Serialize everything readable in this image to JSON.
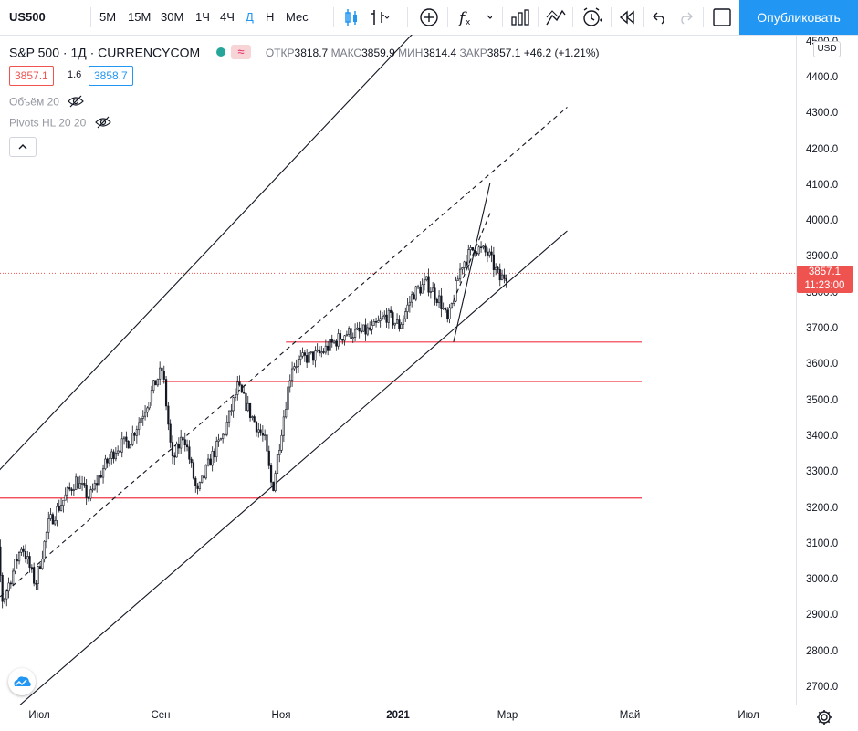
{
  "toolbar": {
    "symbol": "US500",
    "intervals": [
      "5M",
      "15M",
      "30M",
      "1Ч",
      "4Ч",
      "Д",
      "Н",
      "Мес"
    ],
    "active_interval": "Д",
    "publish_label": "Опубликовать"
  },
  "legend": {
    "title": "S&P 500 · 1Д · CURRENCYCOM",
    "open_label": "ОТКР",
    "open": "3818.7",
    "high_label": "МАКС",
    "high": "3859.9",
    "low_label": "МИН",
    "low": "3814.4",
    "close_label": "ЗАКР",
    "close": "3857.1",
    "change": "+46.2 (+1.21%)",
    "bid": "3857.1",
    "spread": "1.6",
    "ask": "3858.7"
  },
  "indicators": [
    {
      "label": "Объём 20"
    },
    {
      "label": "Pivots HL 20 20"
    }
  ],
  "price_axis": {
    "currency": "USD",
    "current_price": "3857.1",
    "countdown": "11:23:00"
  },
  "colors": {
    "up": "#131722",
    "down": "#131722",
    "hline": "#f23645",
    "accent": "#2196f3",
    "price_label": "#ef5350"
  },
  "chart_data": {
    "type": "candlestick",
    "symbol": "S&P 500",
    "x_ticks": [
      "Июл",
      "Сен",
      "Ноя",
      "2021",
      "Мар",
      "Май",
      "Июл"
    ],
    "y_ticks": [
      2700,
      2800,
      2900,
      3000,
      3100,
      3200,
      3300,
      3400,
      3500,
      3600,
      3700,
      3800,
      3900,
      4000,
      4100,
      4200,
      4300,
      4400,
      4500
    ],
    "ylim": [
      2655,
      4520
    ],
    "horizontal_levels": [
      3665,
      3555,
      3230
    ],
    "path": [
      [
        "2020-06-01",
        3050
      ],
      [
        "2020-06-08",
        3180
      ],
      [
        "2020-06-12",
        2940
      ],
      [
        "2020-06-22",
        3100
      ],
      [
        "2020-06-29",
        2990
      ],
      [
        "2020-07-06",
        3160
      ],
      [
        "2020-07-13",
        3220
      ],
      [
        "2020-07-20",
        3280
      ],
      [
        "2020-07-27",
        3230
      ],
      [
        "2020-08-03",
        3310
      ],
      [
        "2020-08-10",
        3370
      ],
      [
        "2020-08-17",
        3390
      ],
      [
        "2020-08-24",
        3470
      ],
      [
        "2020-08-31",
        3560
      ],
      [
        "2020-09-03",
        3590
      ],
      [
        "2020-09-08",
        3330
      ],
      [
        "2020-09-14",
        3410
      ],
      [
        "2020-09-21",
        3240
      ],
      [
        "2020-09-28",
        3340
      ],
      [
        "2020-10-05",
        3410
      ],
      [
        "2020-10-12",
        3540
      ],
      [
        "2020-10-19",
        3460
      ],
      [
        "2020-10-26",
        3390
      ],
      [
        "2020-10-30",
        3250
      ],
      [
        "2020-11-04",
        3430
      ],
      [
        "2020-11-09",
        3600
      ],
      [
        "2020-11-16",
        3620
      ],
      [
        "2020-11-23",
        3630
      ],
      [
        "2020-11-30",
        3660
      ],
      [
        "2020-12-07",
        3690
      ],
      [
        "2020-12-14",
        3690
      ],
      [
        "2020-12-21",
        3700
      ],
      [
        "2020-12-28",
        3740
      ],
      [
        "2021-01-04",
        3710
      ],
      [
        "2021-01-11",
        3800
      ],
      [
        "2021-01-18",
        3830
      ],
      [
        "2021-01-25",
        3780
      ],
      [
        "2021-01-29",
        3720
      ],
      [
        "2021-02-05",
        3880
      ],
      [
        "2021-02-12",
        3930
      ],
      [
        "2021-02-19",
        3910
      ],
      [
        "2021-02-25",
        3840
      ],
      [
        "2021-03-01",
        3857
      ]
    ],
    "trendlines": [
      {
        "style": "solid",
        "from": [
          "2020-06-01",
          3255
        ],
        "to": [
          "2021-04-01",
          4980
        ]
      },
      {
        "style": "dashed",
        "from": [
          "2020-06-01",
          2910
        ],
        "to": [
          "2021-04-01",
          4320
        ]
      },
      {
        "style": "solid",
        "from": [
          "2020-06-01",
          2560
        ],
        "to": [
          "2021-04-01",
          3975
        ]
      },
      {
        "style": "solid",
        "from": [
          "2021-02-01",
          3665
        ],
        "to": [
          "2021-02-20",
          4110
        ]
      },
      {
        "style": "dashed",
        "from": [
          "2021-02-01",
          3780
        ],
        "to": [
          "2021-02-20",
          4025
        ]
      }
    ]
  }
}
